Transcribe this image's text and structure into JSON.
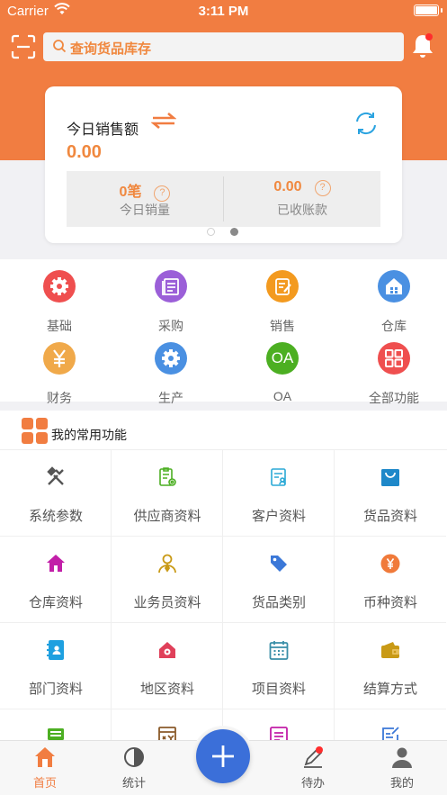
{
  "status_bar": {
    "carrier": "Carrier",
    "time": "3:11 PM"
  },
  "header": {
    "search_placeholder": "查询货品库存"
  },
  "sales_card": {
    "title": "今日销售额",
    "amount": "0.00",
    "stats": [
      {
        "value": "0笔",
        "label": "今日销量"
      },
      {
        "value": "0.00",
        "label": "已收账款"
      }
    ],
    "page_indicator": {
      "pages": 2,
      "active": 2
    }
  },
  "modules": [
    {
      "label": "基础",
      "icon": "gear-icon",
      "color": "#ef4f4f"
    },
    {
      "label": "采购",
      "icon": "purchase-icon",
      "color": "#9b5fd8"
    },
    {
      "label": "销售",
      "icon": "sales-icon",
      "color": "#f39a1f"
    },
    {
      "label": "仓库",
      "icon": "warehouse-icon",
      "color": "#4a90e2"
    },
    {
      "label": "财务",
      "icon": "yen-icon",
      "color": "#f0a94a"
    },
    {
      "label": "生产",
      "icon": "gear-icon",
      "color": "#4a90e2"
    },
    {
      "label": "OA",
      "icon": "oa-icon",
      "color": "#4caf22",
      "icon_text": "OA"
    },
    {
      "label": "全部功能",
      "icon": "grid-icon",
      "color": "#ef4f4f"
    }
  ],
  "common": {
    "title": "我的常用功能",
    "accent": "#f17d41",
    "items": [
      {
        "label": "系统参数",
        "icon": "tools-icon",
        "color": "#555555"
      },
      {
        "label": "供应商资料",
        "icon": "supplier-icon",
        "color": "#4caf22"
      },
      {
        "label": "客户资料",
        "icon": "customer-icon",
        "color": "#2aa9d6"
      },
      {
        "label": "货品资料",
        "icon": "bag-icon",
        "color": "#1e88c9"
      },
      {
        "label": "仓库资料",
        "icon": "home-icon",
        "color": "#c21ea8"
      },
      {
        "label": "业务员资料",
        "icon": "salesman-icon",
        "color": "#c99a16"
      },
      {
        "label": "货品类别",
        "icon": "tag-icon",
        "color": "#3b78d8"
      },
      {
        "label": "币种资料",
        "icon": "currency-icon",
        "color": "#f07a3a"
      },
      {
        "label": "部门资料",
        "icon": "department-icon",
        "color": "#1ea0e0"
      },
      {
        "label": "地区资料",
        "icon": "region-icon",
        "color": "#e0405a"
      },
      {
        "label": "项目资料",
        "icon": "calendar-icon",
        "color": "#3a8fa8"
      },
      {
        "label": "结算方式",
        "icon": "wallet-icon",
        "color": "#c99a16"
      },
      {
        "label": "",
        "icon": "computer-icon",
        "color": "#4caf22"
      },
      {
        "label": "",
        "icon": "invoice-icon",
        "color": "#8a5a2a"
      },
      {
        "label": "",
        "icon": "document-icon",
        "color": "#c21ea8"
      },
      {
        "label": "",
        "icon": "edit-list-icon",
        "color": "#3b78d8"
      }
    ]
  },
  "tabbar": {
    "active_color": "#f17d41",
    "tabs": [
      {
        "label": "首页",
        "icon": "home-icon",
        "active": true
      },
      {
        "label": "统计",
        "icon": "pie-chart-icon",
        "active": false
      },
      {
        "label": "待办",
        "icon": "todo-icon",
        "active": false,
        "badge": true
      },
      {
        "label": "我的",
        "icon": "person-icon",
        "active": false
      }
    ],
    "fab_icon": "plus-icon"
  }
}
